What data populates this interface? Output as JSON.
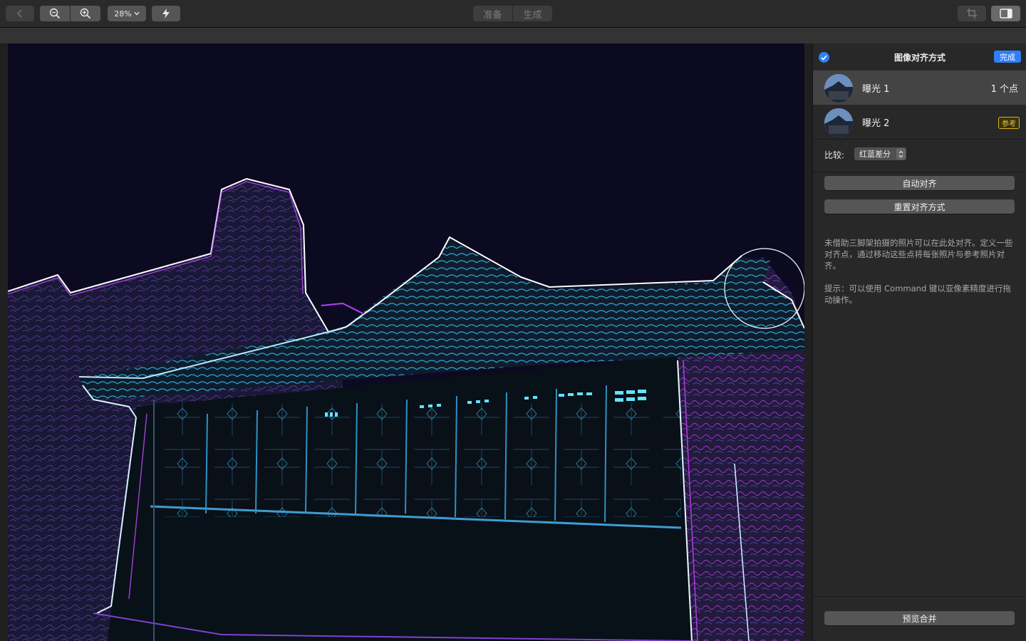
{
  "toolbar": {
    "back_icon": "chevron-left-icon",
    "zoom_out_icon": "zoom-out-icon",
    "zoom_in_icon": "zoom-in-icon",
    "zoom_value": "28%",
    "flash_icon": "lightning-icon",
    "tabs": [
      {
        "label": "准备"
      },
      {
        "label": "生成"
      }
    ],
    "crop_icon": "crop-icon",
    "sidebar_toggle_icon": "sidebar-toggle-icon"
  },
  "sidebar": {
    "title": "图像对齐方式",
    "done_label": "完成",
    "exposures": [
      {
        "name": "曝光 1",
        "meta": "1 个点",
        "selected": true
      },
      {
        "name": "曝光 2",
        "badge": "参考",
        "selected": false
      }
    ],
    "compare": {
      "label": "比较:",
      "value": "红蓝差分"
    },
    "auto_align_label": "自动对齐",
    "reset_align_label": "重置对齐方式",
    "help_text": "未借助三脚架拍摄的照片可以在此处对齐。定义一些对齐点，通过移动这些点将每张照片与参考照片对齐。",
    "tip_text": "提示：可以使用 Command 键以亚像素精度进行拖动操作。",
    "preview_merge_label": "预览合并"
  },
  "colors": {
    "accent": "#2f7ff6",
    "badge": "#d9b21a",
    "edge_cyan": "#3fd0ff",
    "edge_magenta": "#c040ff"
  }
}
